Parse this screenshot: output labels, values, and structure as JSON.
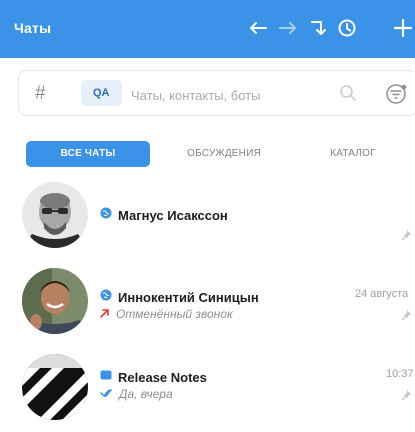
{
  "header": {
    "title": "Чаты",
    "bg_color": "#3a93e6",
    "icons": [
      "arrow-left-icon",
      "arrow-right-icon",
      "jump-icon",
      "history-icon",
      "plus-icon"
    ]
  },
  "search": {
    "hash": "#",
    "qa_label": "QA",
    "placeholder": "Чаты, контакты, боты"
  },
  "tabs": [
    {
      "label": "Все чаты",
      "active": true
    },
    {
      "label": "Обсуждения",
      "active": false
    },
    {
      "label": "Каталог",
      "active": false
    }
  ],
  "chats": [
    {
      "name": "Магнус Исакссон",
      "type_icon": "globe-icon",
      "time": "",
      "subtitle": "",
      "pinned": true
    },
    {
      "name": "Иннокентий Синицын",
      "type_icon": "globe-icon",
      "time": "24 августа",
      "subtitle_icon": "missed-call-icon",
      "subtitle": "Отменённый звонок",
      "pinned": true
    },
    {
      "name": "Release Notes",
      "type_icon": "channel-icon",
      "time": "10:37",
      "subtitle_icon": "read-checkmarks-icon",
      "subtitle": "Да, вчера",
      "pinned": true
    }
  ]
}
